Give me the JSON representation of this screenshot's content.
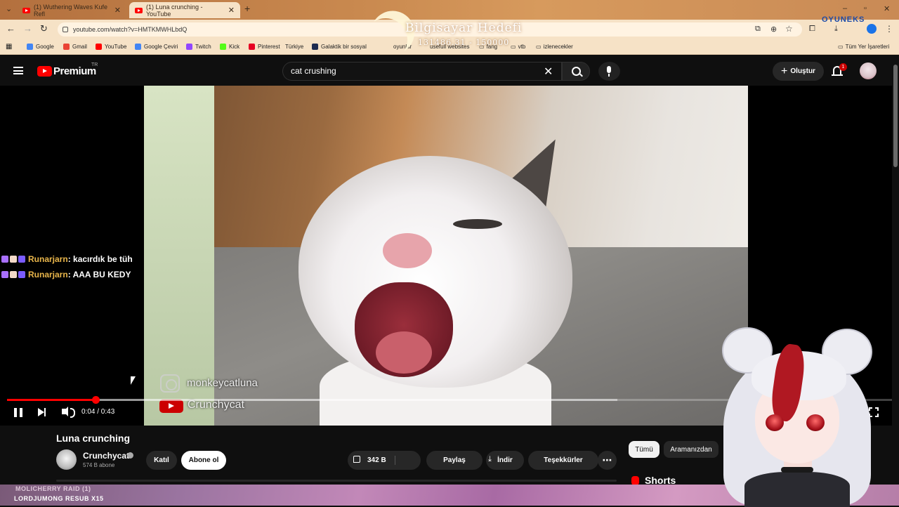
{
  "browser": {
    "tabs": [
      {
        "title": "(1) Wuthering Waves Kufe Refl",
        "active": false
      },
      {
        "title": "(1) Luna crunching - YouTube",
        "active": true
      }
    ],
    "url": "youtube.com/watch?v=HMTKMWHLbdQ",
    "bookmarks": [
      {
        "label": "Google",
        "color": "#4285f4"
      },
      {
        "label": "Gmail",
        "color": "#ea4335"
      },
      {
        "label": "YouTube",
        "color": "#ff0000"
      },
      {
        "label": "Google Çeviri",
        "color": "#4285f4"
      },
      {
        "label": "Twitch",
        "color": "#9146ff"
      },
      {
        "label": "Kick",
        "color": "#53fc18"
      },
      {
        "label": "Pinterest",
        "color": "#e60023"
      },
      {
        "label": "Türkiye",
        "color": "#e30a17"
      },
      {
        "label": "Galaktik bir sosyal",
        "color": "#1d2b4f"
      },
      {
        "label": "oyunlar",
        "color": "#bbbbbb"
      },
      {
        "label": "usefull websites",
        "color": "#bbbbbb"
      },
      {
        "label": "fang",
        "color": "#bbbbbb"
      },
      {
        "label": "vtb",
        "color": "#bbbbbb"
      },
      {
        "label": "izlenecekler",
        "color": "#bbbbbb"
      },
      {
        "label": "Tüm Yer İşaretleri",
        "color": "#bbbbbb"
      }
    ]
  },
  "overlay": {
    "goal_title": "Bilgisayar Hedefi",
    "goal_progress": "131486.31 - 150000",
    "goal_fraction": 0.8766,
    "sponsor": "OYUNEKS"
  },
  "youtube": {
    "brand": "Premium",
    "region": "TR",
    "search_query": "cat crushing",
    "create_label": "Oluştur",
    "notification_count": "1"
  },
  "player": {
    "current_time": "0:04",
    "duration": "0:43",
    "time_display": "0:04 / 0:43",
    "played_fraction": 0.1,
    "buffered_fraction": 0.69,
    "watermark_instagram": "monkeycatluna",
    "watermark_youtube": "Crunchycat"
  },
  "chat": [
    {
      "user": "Runarjarn",
      "message": " : kacırdık be tüh"
    },
    {
      "user": "Runarjarn",
      "message": " : AAA BU KEDY"
    }
  ],
  "video": {
    "title": "Luna crunching",
    "channel": "Crunchycat",
    "subscribers": "574 B abone",
    "join_label": "Katıl",
    "subscribe_label": "Abone ol",
    "likes": "342 B",
    "share_label": "Paylaş",
    "download_label": "İndir",
    "thanks_label": "Teşekkürler",
    "more_label": "⋯"
  },
  "sidebar": {
    "chips": [
      "Tümü",
      "Aramanızdan"
    ],
    "shorts_label": "Shorts"
  },
  "raid": {
    "line1": "MOLICHERRY RAID (1)",
    "line2": "LORDJUMONG RESUB X15"
  }
}
